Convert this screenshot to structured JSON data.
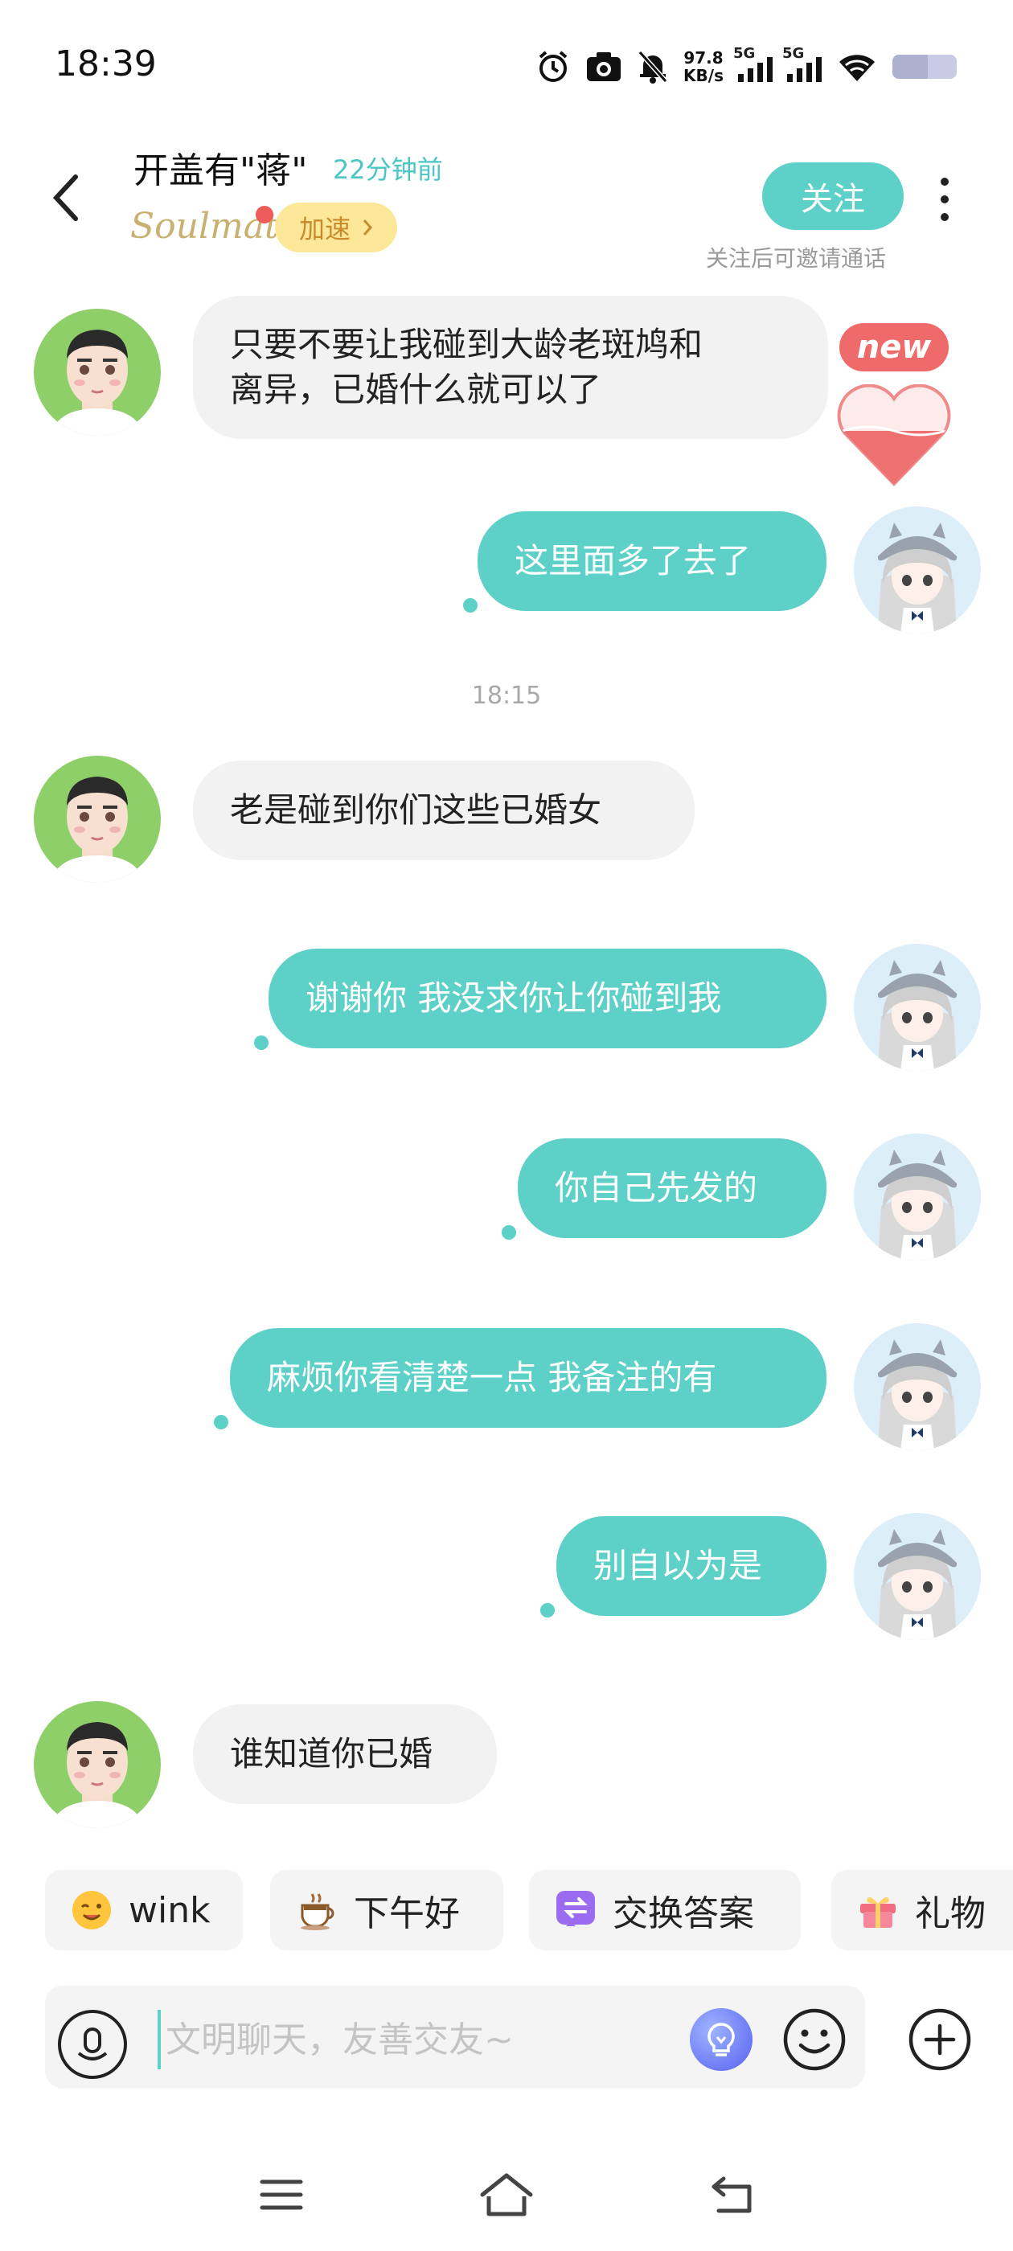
{
  "status_bar": {
    "time": "18:39",
    "net_speed_value": "97.8",
    "net_speed_unit": "KB/s",
    "signal1_label": "5G",
    "signal2_label": "5G",
    "battery_level": 0.55
  },
  "header": {
    "name": "开盖有\"蒋\"",
    "last_seen": "22分钟前",
    "soulmate_label": "Soulmate",
    "speed_label": "加速",
    "follow_label": "关注",
    "follow_hint": "关注后可邀请通话"
  },
  "badges": {
    "new_label": "new"
  },
  "messages": [
    {
      "side": "in",
      "lines": [
        "只要不要让我碰到大龄老斑鸠和",
        "离异，已婚什么就可以了"
      ]
    },
    {
      "side": "out",
      "text": "这里面多了去了"
    },
    {
      "side": "time",
      "text": "18:15"
    },
    {
      "side": "in",
      "text": "老是碰到你们这些已婚女"
    },
    {
      "side": "out",
      "text": "谢谢你 我没求你让你碰到我"
    },
    {
      "side": "out",
      "text": "你自己先发的"
    },
    {
      "side": "out",
      "text": "麻烦你看清楚一点 我备注的有"
    },
    {
      "side": "out",
      "text": "别自以为是"
    },
    {
      "side": "in",
      "text": "谁知道你已婚"
    }
  ],
  "quick_chips": [
    {
      "label": "wink",
      "icon": "wink-emoji-icon"
    },
    {
      "label": "下午好",
      "icon": "coffee-cup-icon"
    },
    {
      "label": "交换答案",
      "icon": "exchange-icon"
    },
    {
      "label": "礼物",
      "icon": "gift-icon"
    }
  ],
  "input": {
    "placeholder": "文明聊天，友善交友~"
  },
  "colors": {
    "accent": "#5dd0c8",
    "incoming_bubble": "#f2f2f2",
    "speed_pill": "#fde89a",
    "new_badge": "#ef6a6a"
  }
}
